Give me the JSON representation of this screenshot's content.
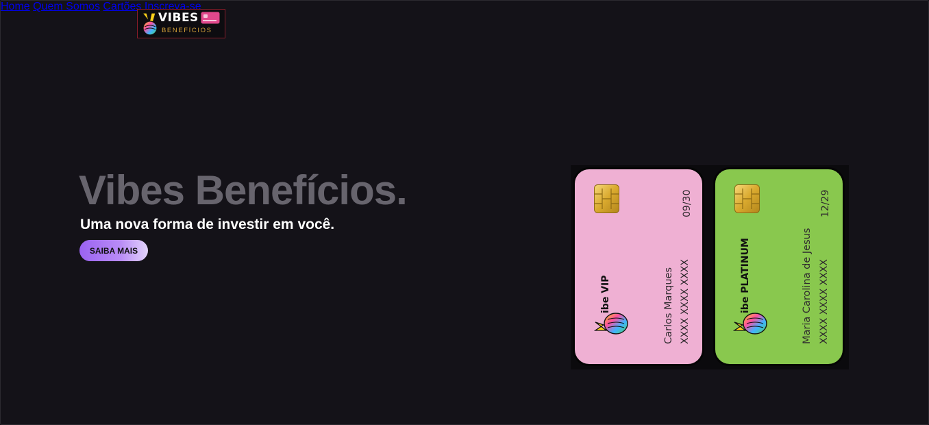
{
  "header": {
    "logo": {
      "title": "VIBES",
      "subtitle": "BENEFÍCIOS"
    },
    "nav": [
      {
        "label": "Home"
      },
      {
        "label": "Quem Somos"
      },
      {
        "label": "Cartões"
      },
      {
        "label": "Inscreva-se"
      }
    ]
  },
  "hero": {
    "title": "Vibes Benefícios.",
    "subtitle": "Uma nova forma de investir em você.",
    "cta_label": "SAIBA MAIS"
  },
  "cards": [
    {
      "color": "#efb0d3",
      "brand": "ibe VIP",
      "holder": "Carlos Marques",
      "number": "XXXX XXXX XXXX",
      "expiry": "09/30"
    },
    {
      "color": "#89c84e",
      "brand": "ibe PLATINUM",
      "holder": "Maria Carolina de Jesus",
      "number": "XXXX XXXX XXXX",
      "expiry": "12/29"
    }
  ],
  "icons": {
    "logo_hand": "peace-hand-icon",
    "logo_card": "credit-card-icon",
    "chip": "card-chip-icon",
    "card_hand": "peace-hand-icon"
  },
  "colors": {
    "background": "#141218",
    "accent": "#9a62f2",
    "title_gray": "#67646d",
    "nav_text": "#a9a7ae"
  }
}
